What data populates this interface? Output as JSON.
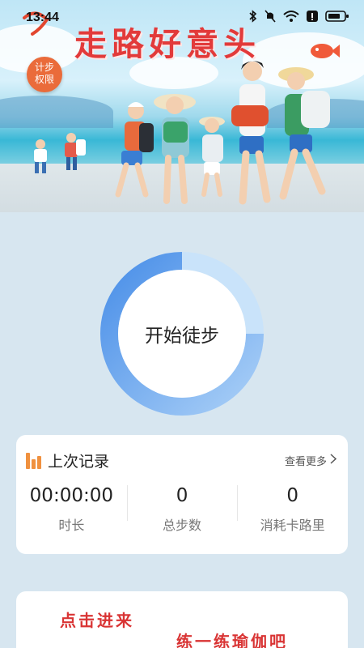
{
  "status_bar": {
    "time": "13:44",
    "icons": [
      "bluetooth-icon",
      "mute-icon",
      "wifi-icon",
      "alert-icon",
      "battery-icon"
    ]
  },
  "hero": {
    "title": "走路好意头",
    "permission_badge": {
      "line1": "计步",
      "line2": "权限"
    }
  },
  "start_button": {
    "label": "开始徒步",
    "accent": "#4a8fe8"
  },
  "last_record": {
    "title": "上次记录",
    "more_label": "查看更多",
    "stats": [
      {
        "value": "00:00:00",
        "label": "时长"
      },
      {
        "value": "0",
        "label": "总步数"
      },
      {
        "value": "0",
        "label": "消耗卡路里"
      }
    ]
  },
  "promo": {
    "line1": "点击进来",
    "line2": "练一练瑜伽吧"
  },
  "colors": {
    "background": "#d7e6f0",
    "title_red": "#e23a3a",
    "badge_orange": "#ea6b3a",
    "chart_icon": "#f0913f"
  }
}
